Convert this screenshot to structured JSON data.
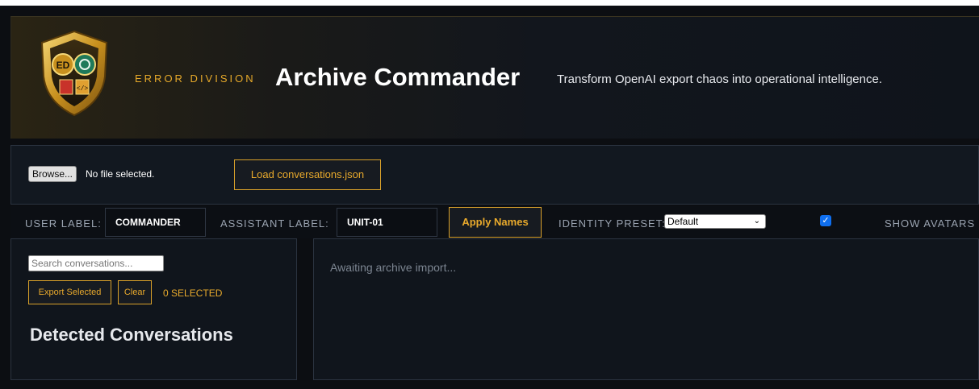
{
  "header": {
    "kicker": "ERROR DIVISION",
    "title": "Archive Commander",
    "tagline": "Transform OpenAI export chaos into operational intelligence."
  },
  "file_panel": {
    "browse_label": "Browse...",
    "file_status": "No file selected.",
    "load_label": "Load conversations.json"
  },
  "identity": {
    "user_label": "USER LABEL:",
    "user_value": "COMMANDER",
    "assistant_label": "ASSISTANT LABEL:",
    "assistant_value": "UNIT-01",
    "apply_label": "Apply Names",
    "preset_label": "IDENTITY PRESET:",
    "preset_value": "Default",
    "show_avatars_label": "SHOW AVATARS",
    "show_avatars_checked": true
  },
  "sidebar": {
    "search_placeholder": "Search conversations...",
    "export_label": "Export Selected",
    "clear_label": "Clear",
    "selected_count": "0 SELECTED",
    "heading": "Detected Conversations"
  },
  "main": {
    "status": "Awaiting archive import..."
  },
  "colors": {
    "accent": "#e9aa2c",
    "background": "#0c0e12",
    "panel": "#10151c"
  },
  "icons": {
    "logo": "shield-emblem-icon",
    "checkbox": "checkmark-icon",
    "select_arrow": "chevron-down-icon"
  }
}
